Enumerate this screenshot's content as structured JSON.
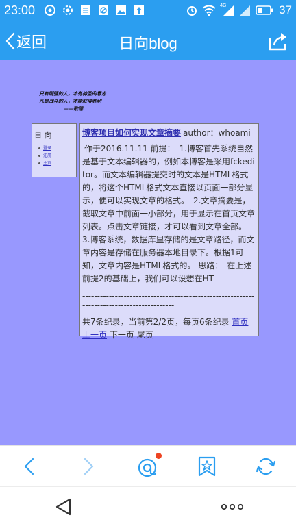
{
  "status_bar": {
    "time": "23:00",
    "battery": "37",
    "network": "4G",
    "icons_left": [
      "circle-icon",
      "gear-icon",
      "document-icon",
      "no-image-icon",
      "image-icon",
      "upload-icon"
    ],
    "icons_right": [
      "alarm-icon",
      "wifi-icon",
      "signal-icon",
      "signal-icon",
      "battery-icon"
    ]
  },
  "header": {
    "back_label": "返回",
    "title": "日向blog"
  },
  "page": {
    "motto": {
      "line1": "只有刚强的人，才有神圣的意志",
      "line2": "凡是战斗的人，才能取得胜利",
      "signature": "——歌德"
    },
    "side_nav": {
      "title": "日 向",
      "links": [
        "登录",
        "注册",
        "主页"
      ]
    },
    "article": {
      "title": "博客项目如何实现文章摘要",
      "author": "author：whoami",
      "body": "作于2016.11.11 前提：　1.博客首先系统自然是基于文本编辑器的，例如本博客是采用fckeditor。而文本编辑器提交时的文本是HTML格式的，将这个HTML格式文本直接以页面一部分显示，便可以实现文章的格式。　2.文章摘要是，截取文章中前面一小部分，用于显示在首页文章列表。点击文章链接，才可以看到文章全部。　3.博客系统，数据库里存储的是文章路径，而文章内容是存储在服务器本地目录下。根据1可知，文章内容是HTML格式的。 思路：　在上述前提2的基础上，我们可以设想在HT",
      "divider": "-----------------------------------------------------------------------------------------",
      "pager": {
        "summary": "共7条纪录，当前第2/2页，每页6条纪录",
        "first": "首页",
        "prev": "上一页",
        "next": "下一页",
        "last": "尾页"
      }
    }
  },
  "toolbar": {
    "items": [
      "back-icon",
      "forward-icon",
      "chat-icon",
      "bookmark-star-icon",
      "refresh-icon"
    ],
    "accent": "#2b9ef0",
    "disabled": "#9fcff6",
    "badge_color": "#ee4422"
  },
  "colors": {
    "header_bg": "#2b9ef0",
    "content_bg": "#9898fe",
    "panel_bg": "#dcdcfa",
    "link": "#3030c0"
  }
}
